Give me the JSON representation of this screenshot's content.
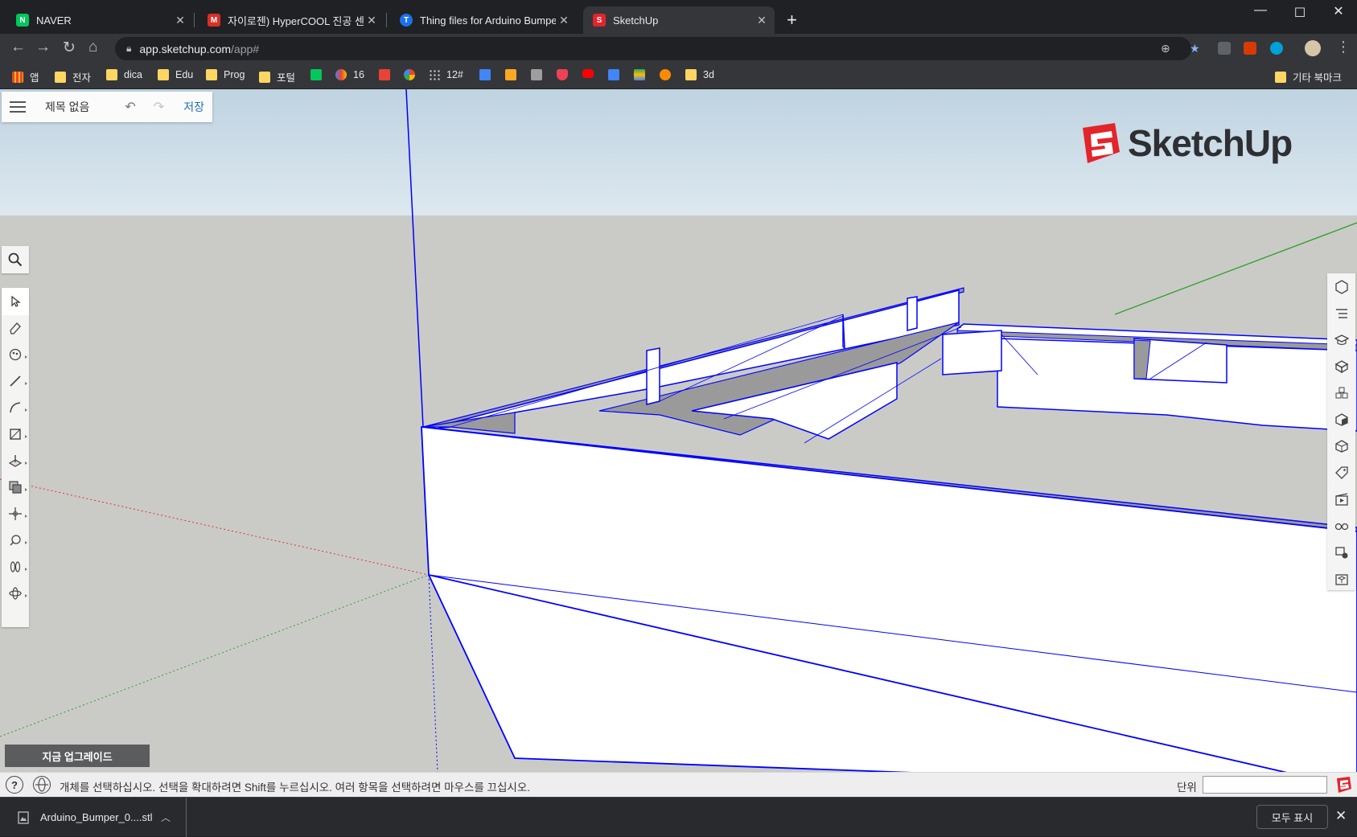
{
  "browser": {
    "tabs": [
      {
        "title": "NAVER",
        "favicon_letter": "N",
        "favicon_color": "#03c75a",
        "active": false
      },
      {
        "title": "자이로젠) HyperCOOL 진공 센서",
        "favicon_letter": "M",
        "favicon_color": "#d93025",
        "active": false
      },
      {
        "title": "Thing files for Arduino Bumper",
        "favicon_letter": "T",
        "favicon_color": "#1a73e8",
        "active": false
      },
      {
        "title": "SketchUp",
        "favicon_letter": "S",
        "favicon_color": "#e3242b",
        "active": true
      }
    ],
    "url_host": "app.sketchup.com",
    "url_path": "/app#",
    "bookmarks": [
      {
        "label": "앱",
        "icon": "apps-grid-icon"
      },
      {
        "label": "전자",
        "icon": "folder-icon"
      },
      {
        "label": "dica",
        "icon": "folder-icon"
      },
      {
        "label": "Edu",
        "icon": "folder-icon"
      },
      {
        "label": "Prog",
        "icon": "folder-icon"
      },
      {
        "label": "포털",
        "icon": "folder-icon"
      },
      {
        "label": "",
        "icon": "naver-icon"
      },
      {
        "label": "16",
        "icon": "daum-icon"
      },
      {
        "label": "",
        "icon": "gmail-icon"
      },
      {
        "label": "",
        "icon": "photos-icon"
      },
      {
        "label": "12#",
        "icon": "dots-icon"
      },
      {
        "label": "",
        "icon": "calendar-icon"
      },
      {
        "label": "",
        "icon": "r-icon"
      },
      {
        "label": "",
        "icon": "print-icon"
      },
      {
        "label": "",
        "icon": "pocket-icon"
      },
      {
        "label": "",
        "icon": "youtube-icon"
      },
      {
        "label": "",
        "icon": "translate-icon"
      },
      {
        "label": "",
        "icon": "maps-icon"
      },
      {
        "label": "",
        "icon": "swirl-icon"
      },
      {
        "label": "3d",
        "icon": "folder-icon"
      }
    ],
    "other_bookmarks": "기타 북마크"
  },
  "app": {
    "menu": {
      "title": "제목 없음",
      "save_label": "저장"
    },
    "logo_text": "SketchUp",
    "upgrade_label": "지금 업그레이드",
    "status_message": "개체를 선택하십시오. 선택을 확대하려면 Shift를 누르십시오. 여러 항목을 선택하려면 마우스를 끄십시오.",
    "help_glyph": "?",
    "units_label": "단위",
    "units_value": "",
    "left_tools": [
      "search-icon",
      "select-arrow-icon",
      "eraser-icon",
      "paint-bucket-icon",
      "pencil-icon",
      "arc-icon",
      "rectangle-icon",
      "push-pull-icon",
      "offset-icon",
      "move-icon",
      "tape-measure-icon",
      "walk-icon",
      "orbit-icon"
    ],
    "right_tools": [
      "entity-info-icon",
      "outliner-icon",
      "instructor-icon",
      "components-icon",
      "materials-icon",
      "styles-icon",
      "layers-icon",
      "tags-icon",
      "scenes-icon",
      "display-icon",
      "solid-tools-icon",
      "3d-warehouse-icon"
    ],
    "colors": {
      "selection_edge": "#0000ff",
      "face": "#ffffff",
      "back_face": "#9a9a9a",
      "ground": "#cacbc7",
      "sky": "#c6d8e4",
      "axis_green": "#2ca02c",
      "axis_red": "#e03030"
    }
  },
  "downloads": {
    "file_name": "Arduino_Bumper_0....stl",
    "show_all": "모두 표시"
  }
}
